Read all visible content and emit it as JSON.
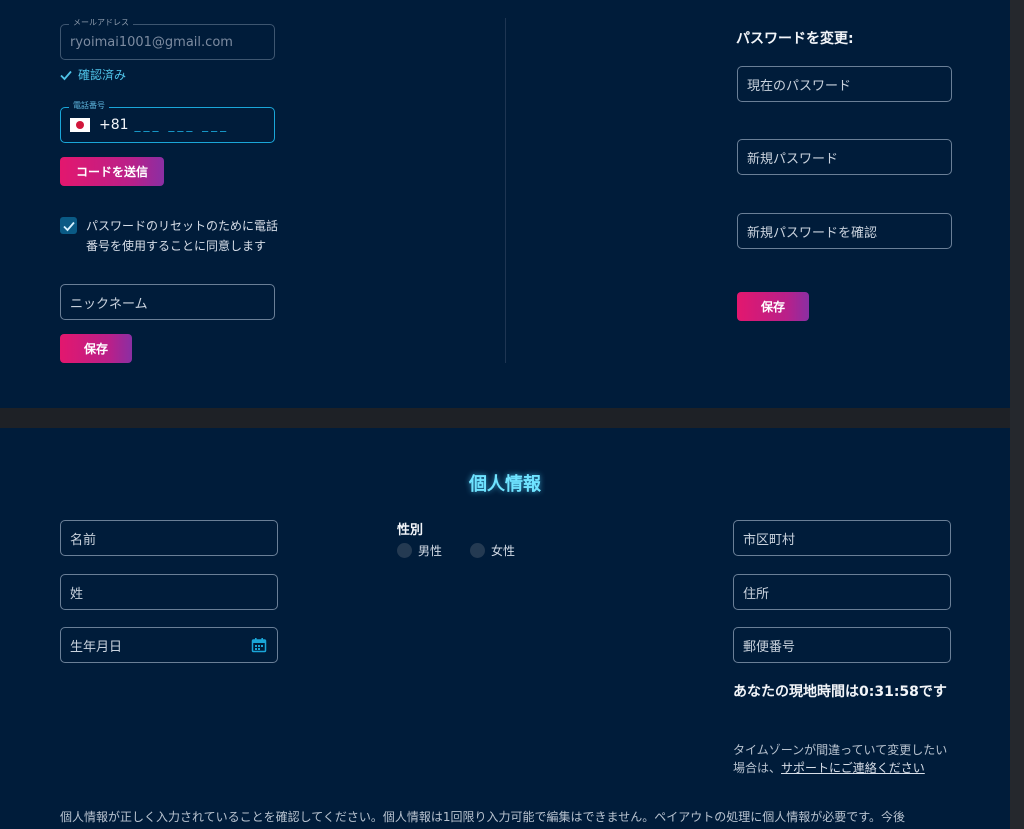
{
  "account": {
    "email": {
      "label": "メールアドレス",
      "value": "ryoimai1001@gmail.com",
      "verified_text": "確認済み"
    },
    "phone": {
      "label": "電話番号",
      "country_code": "+81",
      "mask": "___ ___ ___"
    },
    "send_code_button": "コードを送信",
    "consent_text": "パスワードのリセットのために電話番号を使用することに同意します",
    "nickname_placeholder": "ニックネーム",
    "save_button": "保存"
  },
  "password": {
    "title": "パスワードを変更:",
    "current_placeholder": "現在のパスワード",
    "new_placeholder": "新規パスワード",
    "confirm_placeholder": "新規パスワードを確認",
    "save_button": "保存"
  },
  "personal_info": {
    "title": "個人情報",
    "first_name_placeholder": "名前",
    "last_name_placeholder": "姓",
    "birthdate_placeholder": "生年月日",
    "gender_label": "性別",
    "gender_options": [
      "男性",
      "女性"
    ],
    "city_placeholder": "市区町村",
    "address_placeholder": "住所",
    "postal_placeholder": "郵便番号",
    "local_time_text": "あなたの現地時間は0:31:58です",
    "timezone_note": "タイムゾーンが間違っていて変更したい場合は、",
    "support_link": "サポートにご連絡ください",
    "bottom_note": "個人情報が正しく入力されていることを確認してください。個人情報は1回限り入力可能で編集はできません。ペイアウトの処理に個人情報が必要です。今後"
  },
  "colors": {
    "panel_bg": "#001c3a",
    "accent_cyan": "#4fc3e8",
    "button_gradient_start": "#e3176e",
    "button_gradient_end": "#8a2fa3"
  },
  "icons": {
    "verified": "check-icon",
    "checkbox": "checkbox-checked-icon",
    "flag": "japan-flag-icon",
    "calendar": "calendar-icon"
  }
}
